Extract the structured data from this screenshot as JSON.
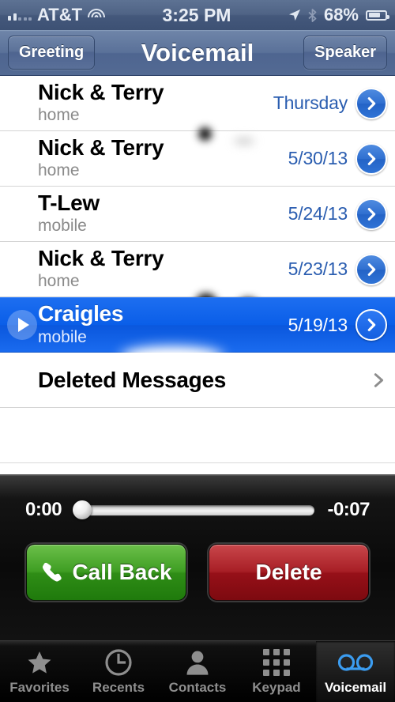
{
  "status_bar": {
    "signal_label": "signal-bars",
    "signal_bars_filled": 2,
    "signal_bars_total": 5,
    "carrier": "AT&T",
    "wifi": "wifi-icon",
    "time": "3:25 PM",
    "location": "location-arrow-icon",
    "bluetooth": "bluetooth-icon",
    "battery_percent": "68%",
    "battery_level": 68
  },
  "nav_bar": {
    "left_button": "Greeting",
    "title": "Voicemail",
    "right_button": "Speaker"
  },
  "messages": [
    {
      "name": "Nick & Terry",
      "label": "home",
      "date": "Thursday",
      "selected": false,
      "redacted": true
    },
    {
      "name": "Nick & Terry",
      "label": "home",
      "date": "5/30/13",
      "selected": false,
      "redacted": false
    },
    {
      "name": "T-Lew",
      "label": "mobile",
      "date": "5/24/13",
      "selected": false,
      "redacted": false
    },
    {
      "name": "Nick & Terry",
      "label": "home",
      "date": "5/23/13",
      "selected": false,
      "redacted": true
    },
    {
      "name": "Craigles",
      "label": "mobile",
      "date": "5/19/13",
      "selected": true,
      "redacted": true
    }
  ],
  "deleted_messages": {
    "label": "Deleted Messages",
    "chevron": "chevron-right-icon"
  },
  "player": {
    "elapsed": "0:00",
    "remaining": "-0:07",
    "progress_percent": 0,
    "call_back_label": "Call Back",
    "delete_label": "Delete",
    "phone_icon": "phone-icon"
  },
  "tab_bar": {
    "items": [
      {
        "label": "Favorites",
        "icon": "star-icon",
        "active": false
      },
      {
        "label": "Recents",
        "icon": "clock-icon",
        "active": false
      },
      {
        "label": "Contacts",
        "icon": "person-icon",
        "active": false
      },
      {
        "label": "Keypad",
        "icon": "keypad-icon",
        "active": false
      },
      {
        "label": "Voicemail",
        "icon": "voicemail-icon",
        "active": true
      }
    ]
  },
  "colors": {
    "accent_blue": "#2a5db0",
    "selected_row": "#0a5ee8",
    "call_back_green": "#3f9e23",
    "delete_red": "#a81f26",
    "voicemail_active": "#3b9cf0"
  }
}
